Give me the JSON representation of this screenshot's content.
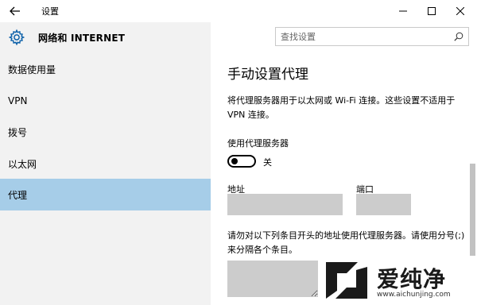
{
  "window": {
    "title": "设置",
    "back_icon": "back-arrow-icon",
    "controls": [
      "minimize-icon",
      "maximize-icon",
      "close-icon"
    ]
  },
  "header": {
    "icon": "gear-icon",
    "section_title": "网络和 INTERNET",
    "search_placeholder": "查找设置",
    "search_icon": "search-icon"
  },
  "sidebar": {
    "items": [
      {
        "label": "数据使用量",
        "selected": false
      },
      {
        "label": "VPN",
        "selected": false
      },
      {
        "label": "拨号",
        "selected": false
      },
      {
        "label": "以太网",
        "selected": false
      },
      {
        "label": "代理",
        "selected": true
      }
    ],
    "selected_color": "#a6cde8"
  },
  "content": {
    "title": "手动设置代理",
    "description": "将代理服务器用于以太网或 Wi-Fi 连接。这些设置不适用于 VPN 连接。",
    "use_proxy_label": "使用代理服务器",
    "toggle_state": "关",
    "toggle_on": false,
    "address_label": "地址",
    "address_value": "",
    "port_label": "端口",
    "port_value": "",
    "exceptions_description": "请勿对以下列条目开头的地址使用代理服务器。请使用分号(;)来分隔各个条目。",
    "exceptions_value": ""
  },
  "watermark": {
    "text": "爱纯净",
    "url": "www.aichunjing.com"
  }
}
